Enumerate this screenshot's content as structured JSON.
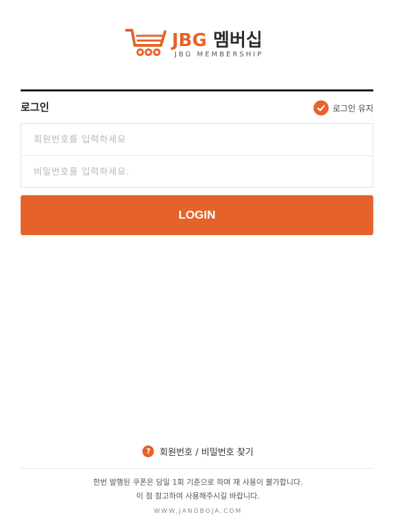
{
  "header": {
    "brand_en": "JBG",
    "brand_ko": "멤버십",
    "subtitle": "JBG MEMBERSHIP",
    "logo_icon": "shopping-cart-icon"
  },
  "login": {
    "title": "로그인",
    "keep_login_label": "로그인 유지",
    "keep_login_checked": true,
    "member_number_placeholder": "회원번호를 입력하세요",
    "member_number_value": "",
    "password_placeholder": "비밀번호를 입력하세요.",
    "password_value": "",
    "submit_label": "LOGIN"
  },
  "footer": {
    "find_label": "회원번호 / 비밀번호 찾기",
    "find_icon": "question-icon",
    "notice_line1": "한번 발행된 쿠폰은 당일 1회 기준으로 하며 재 사용이 불가합니다.",
    "notice_line2": "이 점 참고하여 사용해주시길 바랍니다.",
    "website": "WWW.JANGBOJA.COM"
  },
  "colors": {
    "accent": "#e5632a",
    "text_dark": "#222222",
    "divider": "#1c1c1c"
  }
}
